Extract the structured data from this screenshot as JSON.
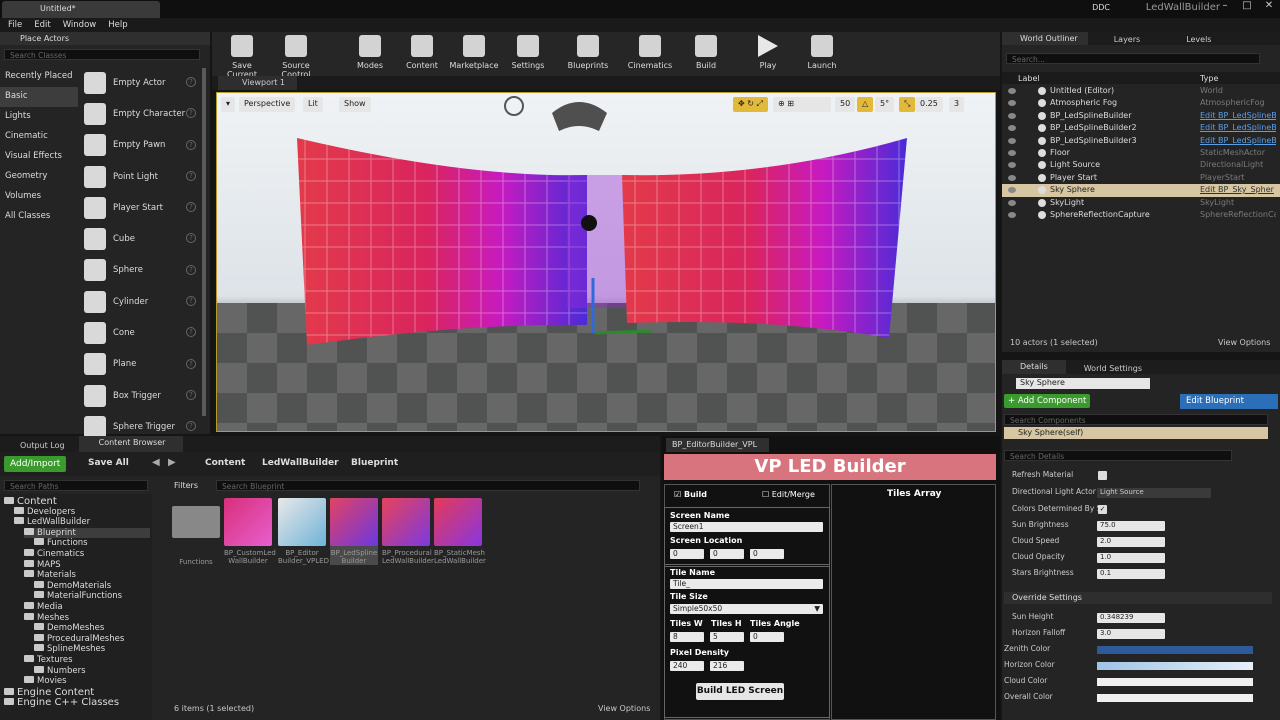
{
  "title_bar": {
    "doc_tab": "Untitled*",
    "ddc": "DDC",
    "project": "LedWallBuilder"
  },
  "menu": [
    "File",
    "Edit",
    "Window",
    "Help"
  ],
  "place_actors": {
    "tab": "Place Actors",
    "search_placeholder": "Search Classes",
    "categories": [
      "Recently Placed",
      "Basic",
      "Lights",
      "Cinematic",
      "Visual Effects",
      "Geometry",
      "Volumes",
      "All Classes"
    ],
    "actors": [
      "Empty Actor",
      "Empty Character",
      "Empty Pawn",
      "Point Light",
      "Player Start",
      "Cube",
      "Sphere",
      "Cylinder",
      "Cone",
      "Plane",
      "Box Trigger",
      "Sphere Trigger"
    ]
  },
  "toolbar": [
    "Save Current",
    "Source Control",
    "Modes",
    "Content",
    "Marketplace",
    "Settings",
    "Blueprints",
    "Cinematics",
    "Build",
    "Play",
    "Launch"
  ],
  "viewport": {
    "tab": "Viewport 1",
    "perspective": "Perspective",
    "lit": "Lit",
    "show": "Show",
    "grid": "50",
    "angle": "5°",
    "scale": "0.25",
    "cam": "3"
  },
  "outliner": {
    "tabs": [
      "World Outliner",
      "Layers",
      "Levels"
    ],
    "search_placeholder": "Search...",
    "col_label": "Label",
    "col_type": "Type",
    "rows": [
      {
        "label": "Untitled (Editor)",
        "type": "World"
      },
      {
        "label": "Atmospheric Fog",
        "type": "AtmosphericFog"
      },
      {
        "label": "BP_LedSplineBuilder",
        "type": "Edit BP_LedSplineB"
      },
      {
        "label": "BP_LedSplineBuilder2",
        "type": "Edit BP_LedSplineB"
      },
      {
        "label": "BP_LedSplineBuilder3",
        "type": "Edit BP_LedSplineB"
      },
      {
        "label": "Floor",
        "type": "StaticMeshActor"
      },
      {
        "label": "Light Source",
        "type": "DirectionalLight"
      },
      {
        "label": "Player Start",
        "type": "PlayerStart"
      },
      {
        "label": "Sky Sphere",
        "type": "Edit BP_Sky_Spher"
      },
      {
        "label": "SkyLight",
        "type": "SkyLight"
      },
      {
        "label": "SphereReflectionCapture",
        "type": "SphereReflectionCap"
      }
    ],
    "count": "10 actors (1 selected)",
    "view_options": "View Options"
  },
  "details": {
    "tabs": [
      "Details",
      "World Settings"
    ],
    "name": "Sky Sphere",
    "add_component": "+ Add Component",
    "edit_blueprint": "Edit Blueprint",
    "search_components": "Search Components",
    "component": "Sky Sphere(self)",
    "search_details": "Search Details",
    "props": [
      {
        "label": "Refresh Material",
        "value": ""
      },
      {
        "label": "Directional Light Actor",
        "value": "Light Source"
      },
      {
        "label": "Colors Determined By Su",
        "value": ""
      },
      {
        "label": "Sun Brightness",
        "value": "75.0"
      },
      {
        "label": "Cloud Speed",
        "value": "2.0"
      },
      {
        "label": "Cloud Opacity",
        "value": "1.0"
      },
      {
        "label": "Stars Brightness",
        "value": "0.1"
      }
    ],
    "override_header": "Override Settings",
    "override": [
      {
        "label": "Sun Height",
        "value": "0.348239"
      },
      {
        "label": "Horizon Falloff",
        "value": "3.0"
      },
      {
        "label": "Zenith Color",
        "value": ""
      },
      {
        "label": "Horizon Color",
        "value": ""
      },
      {
        "label": "Cloud Color",
        "value": ""
      },
      {
        "label": "Overall Color",
        "value": ""
      }
    ]
  },
  "bottom": {
    "tabs": [
      "Output Log",
      "Content Browser"
    ],
    "add_import": "Add/Import",
    "save_all": "Save All",
    "breadcrumb": [
      "Content",
      "LedWallBuilder",
      "Blueprint"
    ],
    "filters": "Filters",
    "search_paths": "Search Paths",
    "search_bp": "Search Blueprint",
    "tree": [
      {
        "t": "Content",
        "big": true,
        "d": 0
      },
      {
        "t": "Developers",
        "d": 1
      },
      {
        "t": "LedWallBuilder",
        "d": 1
      },
      {
        "t": "Blueprint",
        "d": 2
      },
      {
        "t": "Functions",
        "d": 3
      },
      {
        "t": "Cinematics",
        "d": 2
      },
      {
        "t": "MAPS",
        "d": 2
      },
      {
        "t": "Materials",
        "d": 2
      },
      {
        "t": "DemoMaterials",
        "d": 3
      },
      {
        "t": "MaterialFunctions",
        "d": 3
      },
      {
        "t": "Media",
        "d": 2
      },
      {
        "t": "Meshes",
        "d": 2
      },
      {
        "t": "DemoMeshes",
        "d": 3
      },
      {
        "t": "ProceduralMeshes",
        "d": 3
      },
      {
        "t": "SplineMeshes",
        "d": 3
      },
      {
        "t": "Textures",
        "d": 2
      },
      {
        "t": "Numbers",
        "d": 3
      },
      {
        "t": "Movies",
        "d": 2
      },
      {
        "t": "Engine Content",
        "big": true,
        "d": 0
      },
      {
        "t": "Engine C++ Classes",
        "big": true,
        "d": 0
      }
    ],
    "assets": [
      {
        "l1": "Functions",
        "l2": ""
      },
      {
        "l1": "BP_CustomLed",
        "l2": "WallBuilder"
      },
      {
        "l1": "BP_Editor",
        "l2": "Builder_VPLED"
      },
      {
        "l1": "BP_LedSpline",
        "l2": "Builder"
      },
      {
        "l1": "BP_Procedural",
        "l2": "LedWallBuilder"
      },
      {
        "l1": "BP_StaticMesh",
        "l2": "LedWallBuilder"
      }
    ],
    "items": "6 items (1 selected)",
    "view_options": "View Options"
  },
  "led": {
    "tab": "BP_EditorBuilder_VPL",
    "title": "VP LED Builder",
    "build": "Build",
    "edit_merge": "Edit/Merge",
    "tiles_array": "Tiles Array",
    "screen_name_label": "Screen Name",
    "screen_name": "Screen1",
    "screen_loc_label": "Screen Location",
    "loc": [
      "0",
      "0",
      "0"
    ],
    "tile_name_label": "Tile Name",
    "tile_name": "Tile_",
    "tile_size_label": "Tile Size",
    "tile_size": "Simple50x50",
    "tiles_w_label": "Tiles W",
    "tiles_h_label": "Tiles H",
    "tiles_angle_label": "Tiles Angle",
    "tiles_w": "8",
    "tiles_h": "5",
    "tiles_angle": "0",
    "pixel_label": "Pixel Density",
    "px_w": "240",
    "px_h": "216",
    "build_btn": "Build LED Screen"
  }
}
